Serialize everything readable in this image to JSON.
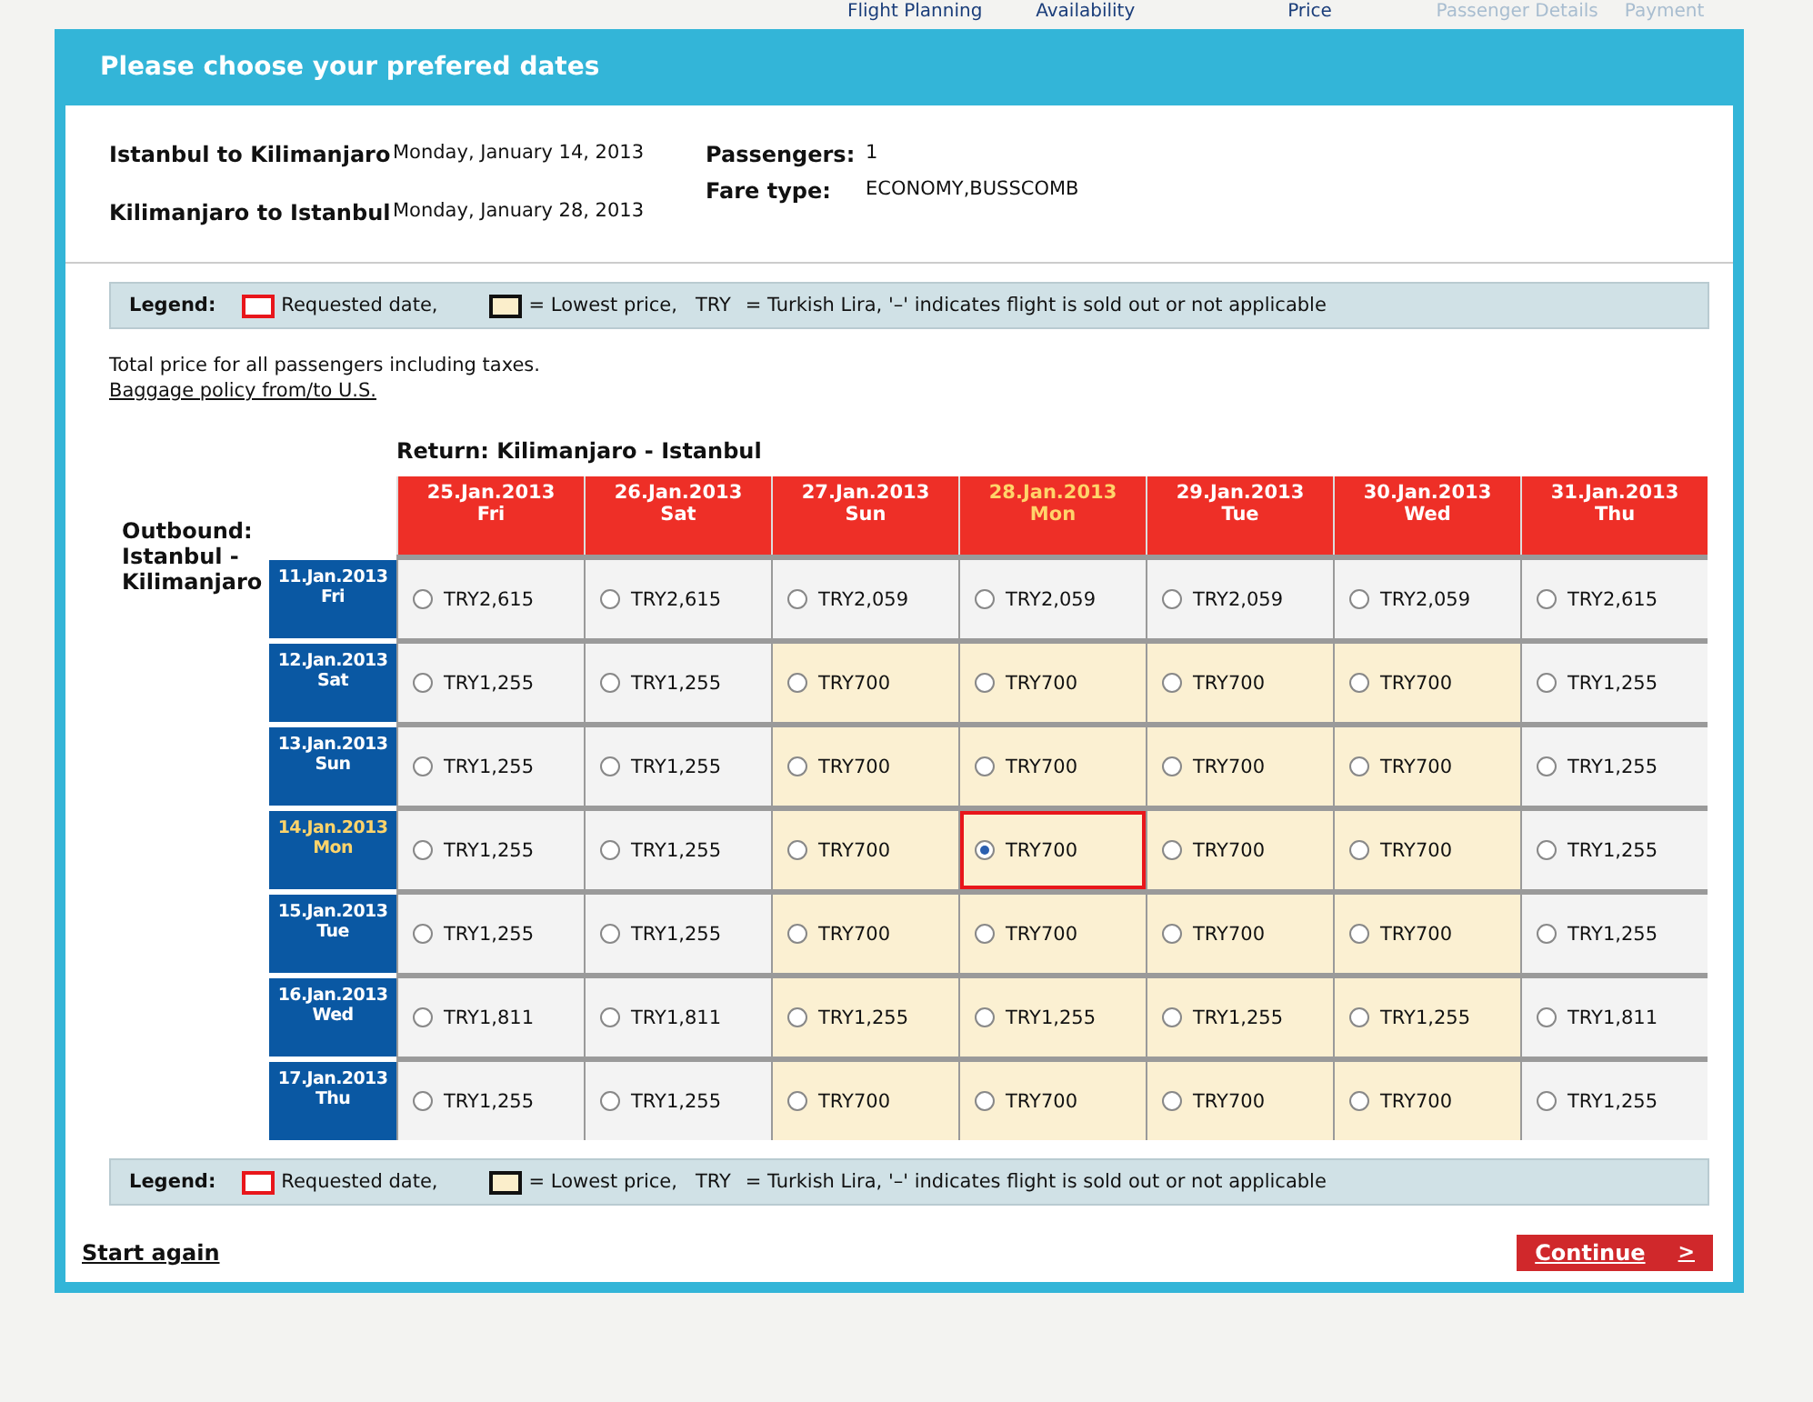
{
  "steps": [
    {
      "label": "Flight Planning",
      "disabled": false
    },
    {
      "label": "Availability",
      "disabled": false
    },
    {
      "label": "Price",
      "disabled": false
    },
    {
      "label": "Passenger Details",
      "disabled": true
    },
    {
      "label": "Payment",
      "disabled": true
    }
  ],
  "title": "Please choose your prefered dates",
  "summary": {
    "legs": [
      {
        "route": "Istanbul to Kilimanjaro",
        "date": "Monday, January 14, 2013"
      },
      {
        "route": "Kilimanjaro to Istanbul",
        "date": "Monday, January 28, 2013"
      }
    ],
    "fields": [
      {
        "label": "Passengers:",
        "value": "1"
      },
      {
        "label": "Fare type:",
        "value": "ECONOMY,BUSSCOMB"
      }
    ]
  },
  "legend": {
    "title": "Legend:",
    "requested": "Requested date,",
    "lowest": "= Lowest price,",
    "currency": "TRY",
    "note": "= Turkish Lira, '–' indicates flight is sold out or not applicable"
  },
  "note": "Total price for all passengers including taxes.",
  "baggage_link": "Baggage policy from/to U.S.",
  "return_label": "Return: Kilimanjaro - Istanbul",
  "outbound_label": "Outbound: Istanbul - Kilimanjaro",
  "columns": [
    {
      "date": "25.Jan.2013",
      "day": "Fri",
      "requested": false
    },
    {
      "date": "26.Jan.2013",
      "day": "Sat",
      "requested": false
    },
    {
      "date": "27.Jan.2013",
      "day": "Sun",
      "requested": false
    },
    {
      "date": "28.Jan.2013",
      "day": "Mon",
      "requested": true
    },
    {
      "date": "29.Jan.2013",
      "day": "Tue",
      "requested": false
    },
    {
      "date": "30.Jan.2013",
      "day": "Wed",
      "requested": false
    },
    {
      "date": "31.Jan.2013",
      "day": "Thu",
      "requested": false
    }
  ],
  "rows": [
    {
      "date": "11.Jan.2013",
      "day": "Fri",
      "requested": false,
      "cells": [
        {
          "price": "TRY2,615",
          "lowest": false,
          "selected": false
        },
        {
          "price": "TRY2,615",
          "lowest": false,
          "selected": false
        },
        {
          "price": "TRY2,059",
          "lowest": false,
          "selected": false
        },
        {
          "price": "TRY2,059",
          "lowest": false,
          "selected": false
        },
        {
          "price": "TRY2,059",
          "lowest": false,
          "selected": false
        },
        {
          "price": "TRY2,059",
          "lowest": false,
          "selected": false
        },
        {
          "price": "TRY2,615",
          "lowest": false,
          "selected": false
        }
      ]
    },
    {
      "date": "12.Jan.2013",
      "day": "Sat",
      "requested": false,
      "cells": [
        {
          "price": "TRY1,255",
          "lowest": false,
          "selected": false
        },
        {
          "price": "TRY1,255",
          "lowest": false,
          "selected": false
        },
        {
          "price": "TRY700",
          "lowest": true,
          "selected": false
        },
        {
          "price": "TRY700",
          "lowest": true,
          "selected": false
        },
        {
          "price": "TRY700",
          "lowest": true,
          "selected": false
        },
        {
          "price": "TRY700",
          "lowest": true,
          "selected": false
        },
        {
          "price": "TRY1,255",
          "lowest": false,
          "selected": false
        }
      ]
    },
    {
      "date": "13.Jan.2013",
      "day": "Sun",
      "requested": false,
      "cells": [
        {
          "price": "TRY1,255",
          "lowest": false,
          "selected": false
        },
        {
          "price": "TRY1,255",
          "lowest": false,
          "selected": false
        },
        {
          "price": "TRY700",
          "lowest": true,
          "selected": false
        },
        {
          "price": "TRY700",
          "lowest": true,
          "selected": false
        },
        {
          "price": "TRY700",
          "lowest": true,
          "selected": false
        },
        {
          "price": "TRY700",
          "lowest": true,
          "selected": false
        },
        {
          "price": "TRY1,255",
          "lowest": false,
          "selected": false
        }
      ]
    },
    {
      "date": "14.Jan.2013",
      "day": "Mon",
      "requested": true,
      "cells": [
        {
          "price": "TRY1,255",
          "lowest": false,
          "selected": false
        },
        {
          "price": "TRY1,255",
          "lowest": false,
          "selected": false
        },
        {
          "price": "TRY700",
          "lowest": true,
          "selected": false
        },
        {
          "price": "TRY700",
          "lowest": true,
          "selected": true
        },
        {
          "price": "TRY700",
          "lowest": true,
          "selected": false
        },
        {
          "price": "TRY700",
          "lowest": true,
          "selected": false
        },
        {
          "price": "TRY1,255",
          "lowest": false,
          "selected": false
        }
      ]
    },
    {
      "date": "15.Jan.2013",
      "day": "Tue",
      "requested": false,
      "cells": [
        {
          "price": "TRY1,255",
          "lowest": false,
          "selected": false
        },
        {
          "price": "TRY1,255",
          "lowest": false,
          "selected": false
        },
        {
          "price": "TRY700",
          "lowest": true,
          "selected": false
        },
        {
          "price": "TRY700",
          "lowest": true,
          "selected": false
        },
        {
          "price": "TRY700",
          "lowest": true,
          "selected": false
        },
        {
          "price": "TRY700",
          "lowest": true,
          "selected": false
        },
        {
          "price": "TRY1,255",
          "lowest": false,
          "selected": false
        }
      ]
    },
    {
      "date": "16.Jan.2013",
      "day": "Wed",
      "requested": false,
      "cells": [
        {
          "price": "TRY1,811",
          "lowest": false,
          "selected": false
        },
        {
          "price": "TRY1,811",
          "lowest": false,
          "selected": false
        },
        {
          "price": "TRY1,255",
          "lowest": true,
          "selected": false
        },
        {
          "price": "TRY1,255",
          "lowest": true,
          "selected": false
        },
        {
          "price": "TRY1,255",
          "lowest": true,
          "selected": false
        },
        {
          "price": "TRY1,255",
          "lowest": true,
          "selected": false
        },
        {
          "price": "TRY1,811",
          "lowest": false,
          "selected": false
        }
      ]
    },
    {
      "date": "17.Jan.2013",
      "day": "Thu",
      "requested": false,
      "cells": [
        {
          "price": "TRY1,255",
          "lowest": false,
          "selected": false
        },
        {
          "price": "TRY1,255",
          "lowest": false,
          "selected": false
        },
        {
          "price": "TRY700",
          "lowest": true,
          "selected": false
        },
        {
          "price": "TRY700",
          "lowest": true,
          "selected": false
        },
        {
          "price": "TRY700",
          "lowest": true,
          "selected": false
        },
        {
          "price": "TRY700",
          "lowest": true,
          "selected": false
        },
        {
          "price": "TRY1,255",
          "lowest": false,
          "selected": false
        }
      ]
    }
  ],
  "legend_bottom": {
    "title": "Legend:",
    "requested": "Requested date,",
    "lowest": "= Lowest price,",
    "currency": "TRY",
    "note": "= Turkish Lira, '–' indicates flight is sold out or not applicable"
  },
  "start_again": "Start again",
  "continue": {
    "label": "Continue",
    "arrow": ">"
  }
}
